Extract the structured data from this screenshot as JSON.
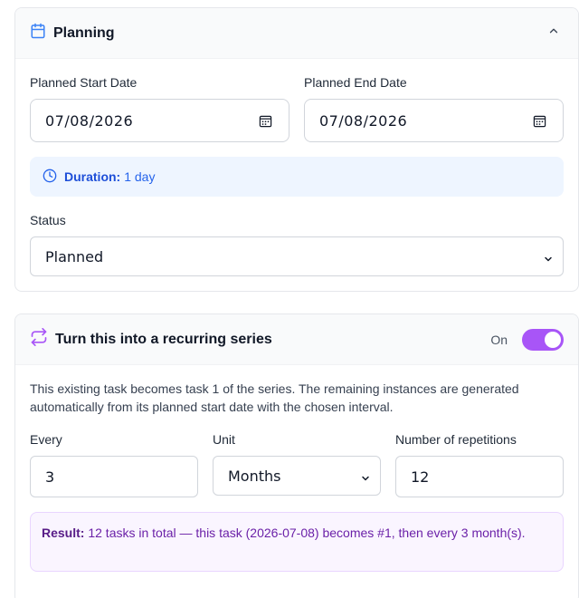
{
  "planning": {
    "title": "Planning",
    "start_label": "Planned Start Date",
    "start_value": "07/08/2026",
    "end_label": "Planned End Date",
    "end_value": "07/08/2026",
    "duration_label": "Duration:",
    "duration_value": "1 day",
    "status_label": "Status",
    "status_value": "Planned"
  },
  "recurring": {
    "title": "Turn this into a recurring series",
    "toggle_label": "On",
    "description": "This existing task becomes task 1 of the series. The remaining instances are generated automatically from its planned start date with the chosen interval.",
    "every_label": "Every",
    "every_value": "3",
    "unit_label": "Unit",
    "unit_value": "Months",
    "reps_label": "Number of repetitions",
    "reps_value": "12",
    "result_label": "Result:",
    "result_text": "12 tasks in total — this task (2026-07-08) becomes #1, then every 3 month(s)."
  },
  "colors": {
    "accent_blue": "#2563eb",
    "accent_purple": "#a855f7"
  }
}
